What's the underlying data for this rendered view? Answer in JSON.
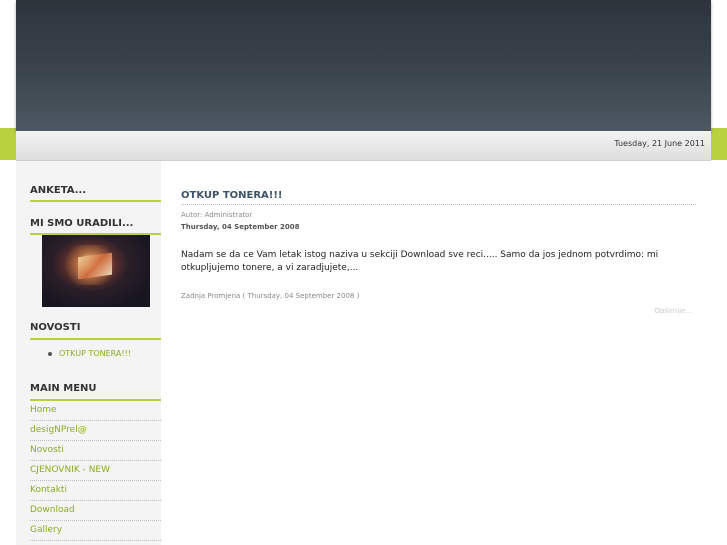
{
  "header": {
    "date": "Tuesday, 21 June 2011"
  },
  "sidebar": {
    "poll_title": "ANKETA...",
    "done_title": "MI SMO URADILI...",
    "news_title": "NOVOSTI",
    "news_items": [
      "OTKUP TONERA!!!"
    ],
    "menu_title": "MAIN MENU",
    "menu_items": [
      "Home",
      "desigNPrel@",
      "Novosti",
      "CJENOVNIK - NEW",
      "Kontakti",
      "Download",
      "Gallery"
    ]
  },
  "article": {
    "title": "OTKUP TONERA!!!",
    "author": "Autor: Administrator",
    "created": "Thursday, 04 September 2008",
    "body": "Nadam se da ce Vam letak istog naziva u sekciji Download sve reci..... Samo da jos jednom potvrdimo: mi otkupljujemo tonere, a vi zaradjujete,...",
    "modified": "Zadnja Promjena ( Thursday, 04 September 2008 )",
    "opinion_link": "Opširnije..."
  },
  "colors": {
    "accent": "#b9d13f",
    "link": "#8aac20",
    "header": "#38414a"
  }
}
